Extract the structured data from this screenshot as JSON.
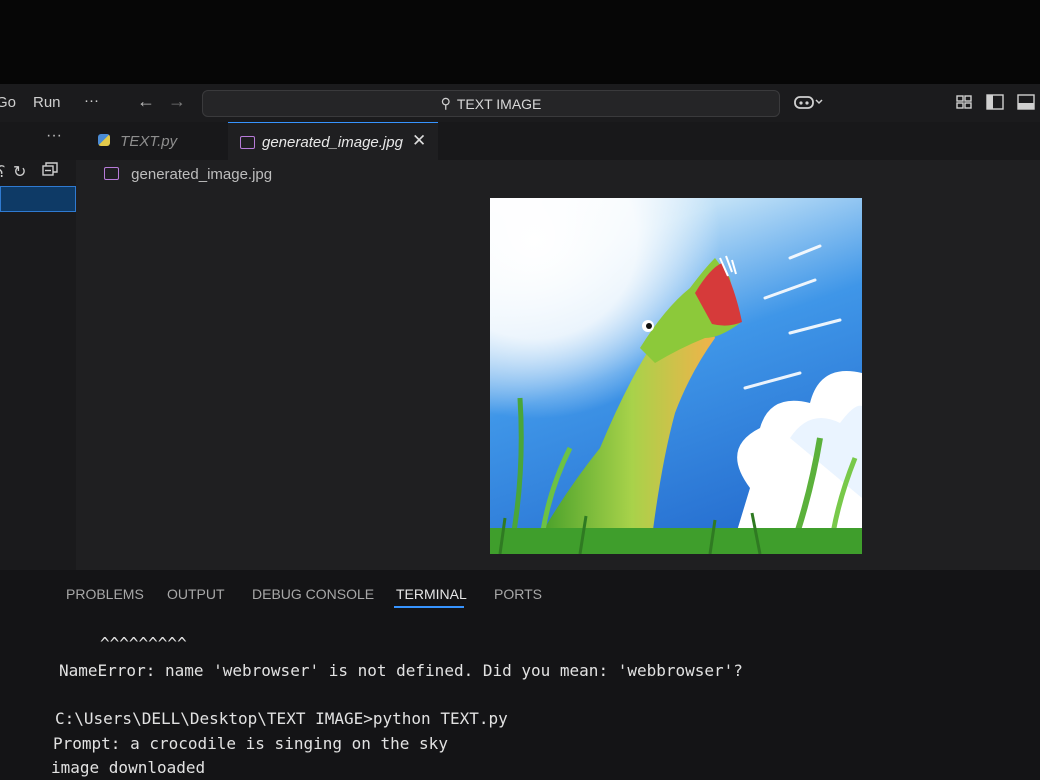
{
  "titlebar": {
    "menu": [
      "Go",
      "Run",
      "···"
    ],
    "search_text": "TEXT IMAGE"
  },
  "explorer": {
    "more_label": "···"
  },
  "tabs": [
    {
      "label": "TEXT.py",
      "icon": "python-file-icon",
      "active": false
    },
    {
      "label": "generated_image.jpg",
      "icon": "image-file-icon",
      "active": true
    }
  ],
  "editor": {
    "breadcrumb": "generated_image.jpg",
    "image_alt": "cartoon crocodile singing under a blue sky"
  },
  "panel": {
    "tabs": [
      "PROBLEMS",
      "OUTPUT",
      "DEBUG CONSOLE",
      "TERMINAL",
      "PORTS"
    ],
    "active_tab": "TERMINAL"
  },
  "terminal": {
    "lines": [
      "^^^^^^^^^",
      "NameError: name 'webrowser' is not defined. Did you mean: 'webbrowser'?",
      "",
      "C:\\Users\\DELL\\Desktop\\TEXT IMAGE>python TEXT.py",
      "Prompt: a crocodile is singing on the sky",
      "image downloaded"
    ]
  },
  "colors": {
    "accent": "#3794ff",
    "selection": "#0e3a66",
    "image_icon": "#b77bd9"
  }
}
